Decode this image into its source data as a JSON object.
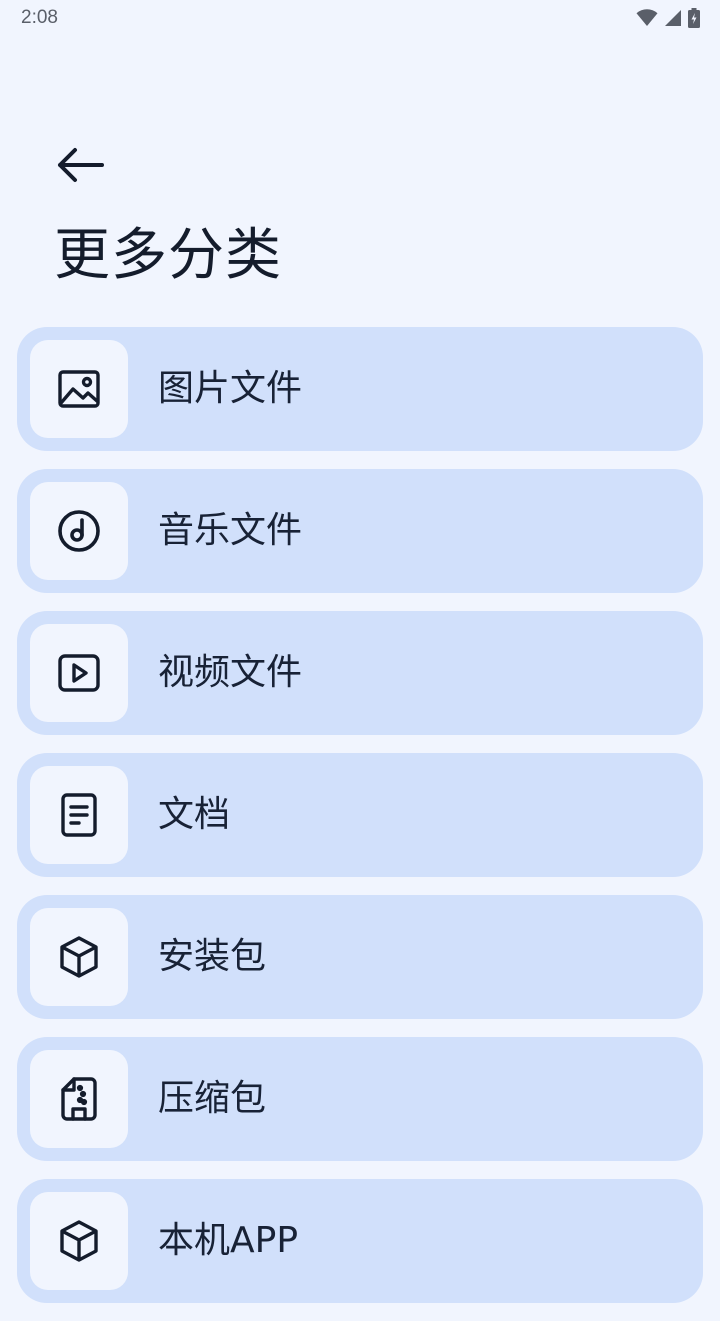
{
  "status_bar": {
    "time": "2:08",
    "icons": [
      "wifi-icon",
      "cell-signal-icon",
      "battery-charging-icon"
    ]
  },
  "header": {
    "back_icon": "arrow-left-icon",
    "title": "更多分类"
  },
  "categories": [
    {
      "label": "图片文件",
      "icon": "image-icon"
    },
    {
      "label": "音乐文件",
      "icon": "music-disc-icon"
    },
    {
      "label": "视频文件",
      "icon": "video-play-icon"
    },
    {
      "label": "文档",
      "icon": "document-icon"
    },
    {
      "label": "安装包",
      "icon": "package-cube-icon"
    },
    {
      "label": "压缩包",
      "icon": "archive-file-icon"
    },
    {
      "label": "本机APP",
      "icon": "app-cube-icon"
    }
  ],
  "colors": {
    "background": "#f1f5fe",
    "card": "#d1e0fb",
    "text": "#141c2c"
  }
}
